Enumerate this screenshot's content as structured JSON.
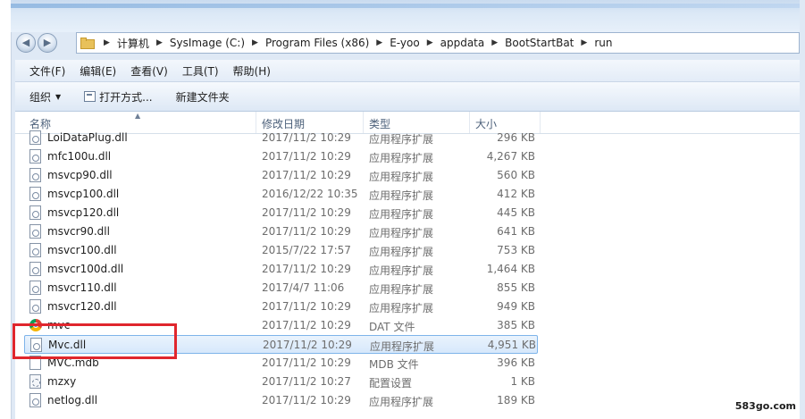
{
  "breadcrumb": [
    "计算机",
    "SysImage (C:)",
    "Program Files (x86)",
    "E-yoo",
    "appdata",
    "BootStartBat",
    "run"
  ],
  "menu": [
    "文件(F)",
    "编辑(E)",
    "查看(V)",
    "工具(T)",
    "帮助(H)"
  ],
  "toolbar": {
    "organize": "组织",
    "open_with": "打开方式...",
    "new_folder": "新建文件夹"
  },
  "columns": {
    "name": "名称",
    "date": "修改日期",
    "type": "类型",
    "size": "大小"
  },
  "files": [
    {
      "name": "LoiDataPlug.dll",
      "date": "2017/11/2 10:29",
      "type": "应用程序扩展",
      "size": "296 KB",
      "icon": "dll-icon"
    },
    {
      "name": "mfc100u.dll",
      "date": "2017/11/2 10:29",
      "type": "应用程序扩展",
      "size": "4,267 KB",
      "icon": "dll-icon"
    },
    {
      "name": "msvcp90.dll",
      "date": "2017/11/2 10:29",
      "type": "应用程序扩展",
      "size": "560 KB",
      "icon": "dll-icon"
    },
    {
      "name": "msvcp100.dll",
      "date": "2016/12/22 10:35",
      "type": "应用程序扩展",
      "size": "412 KB",
      "icon": "dll-icon"
    },
    {
      "name": "msvcp120.dll",
      "date": "2017/11/2 10:29",
      "type": "应用程序扩展",
      "size": "445 KB",
      "icon": "dll-icon"
    },
    {
      "name": "msvcr90.dll",
      "date": "2017/11/2 10:29",
      "type": "应用程序扩展",
      "size": "641 KB",
      "icon": "dll-icon"
    },
    {
      "name": "msvcr100.dll",
      "date": "2015/7/22 17:57",
      "type": "应用程序扩展",
      "size": "753 KB",
      "icon": "dll-icon"
    },
    {
      "name": "msvcr100d.dll",
      "date": "2017/11/2 10:29",
      "type": "应用程序扩展",
      "size": "1,464 KB",
      "icon": "dll-icon"
    },
    {
      "name": "msvcr110.dll",
      "date": "2017/4/7 11:06",
      "type": "应用程序扩展",
      "size": "855 KB",
      "icon": "dll-icon"
    },
    {
      "name": "msvcr120.dll",
      "date": "2017/11/2 10:29",
      "type": "应用程序扩展",
      "size": "949 KB",
      "icon": "dll-icon"
    },
    {
      "name": "mvc",
      "date": "2017/11/2 10:29",
      "type": "DAT 文件",
      "size": "385 KB",
      "icon": "dat-icon"
    },
    {
      "name": "Mvc.dll",
      "date": "2017/11/2 10:29",
      "type": "应用程序扩展",
      "size": "4,951 KB",
      "icon": "dll-icon",
      "selected": true
    },
    {
      "name": "MVC.mdb",
      "date": "2017/11/2 10:29",
      "type": "MDB 文件",
      "size": "396 KB",
      "icon": "blank-icon"
    },
    {
      "name": "mzxy",
      "date": "2017/11/2 10:27",
      "type": "配置设置",
      "size": "1 KB",
      "icon": "cfg-icon"
    },
    {
      "name": "netlog.dll",
      "date": "2017/11/2 10:29",
      "type": "应用程序扩展",
      "size": "189 KB",
      "icon": "dll-icon"
    }
  ],
  "watermark": "583go.com"
}
